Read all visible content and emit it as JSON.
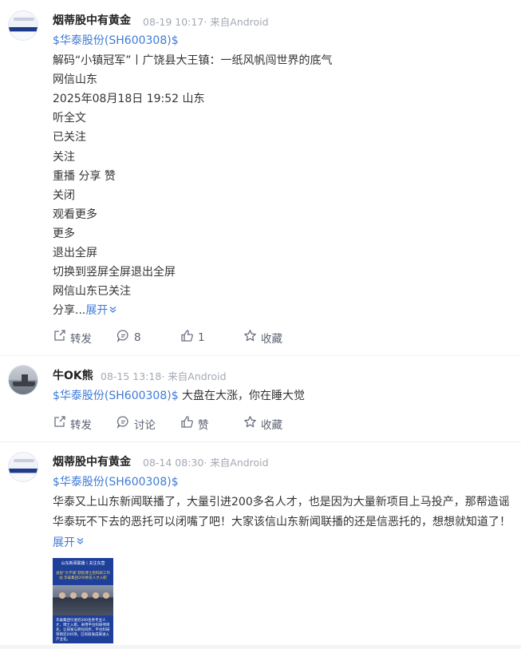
{
  "posts": [
    {
      "author": "烟蒂股中有黄金",
      "meta": "08-19 10:17· 来自Android",
      "stock_tag": "$华泰股份(SH600308)$",
      "lines": [
        "解码“小镇冠军”丨广饶县大王镇：一纸风帆闯世界的底气",
        "网信山东",
        "2025年08月18日 19:52 山东",
        "听全文",
        "已关注",
        "关注",
        "重播 分享 赞",
        "关闭",
        "观看更多",
        "更多",
        "退出全屏",
        "切换到竖屏全屏退出全屏",
        "网信山东已关注"
      ],
      "last_line_prefix": "分享...",
      "expand_label": "展开",
      "actions": {
        "repost": "转发",
        "comment": "8",
        "like": "1",
        "favorite": "收藏"
      }
    },
    {
      "author": "牛OK熊",
      "meta": "08-15 13:18· 来自Android",
      "stock_tag": "$华泰股份(SH600308)$",
      "text": " 大盘在大涨，你在睡大觉",
      "actions": {
        "repost": "转发",
        "comment": "讨论",
        "like": "赞",
        "favorite": "收藏"
      }
    },
    {
      "author": "烟蒂股中有黄金",
      "meta": "08-14 08:30· 来自Android",
      "stock_tag": "$华泰股份(SH600308)$",
      "text": "华泰又上山东新闻联播了，大量引进200多名人才，也是因为大量新项目上马投产，那帮造谣华泰玩不下去的恶托可以闭嘴了吧！大家该信山东新闻联播的还是信恶托的，想想就知道了！",
      "expand_label": "展开",
      "image": {
        "title": "山东新闻联播丨关注东营",
        "subtitle": "总投“大学城”获批博士后科研工作站 华泰集团200余名人才入职",
        "body": "华泰集团引进近200名各专业人才，博士入职，采用平台科研项目化，让研发与转化同步，平台科研项目近200项，已有研发成果进入产业化。"
      }
    }
  ],
  "colors": {
    "link": "#3e7bd6",
    "meta": "#a4a9b3",
    "text": "#333333"
  }
}
